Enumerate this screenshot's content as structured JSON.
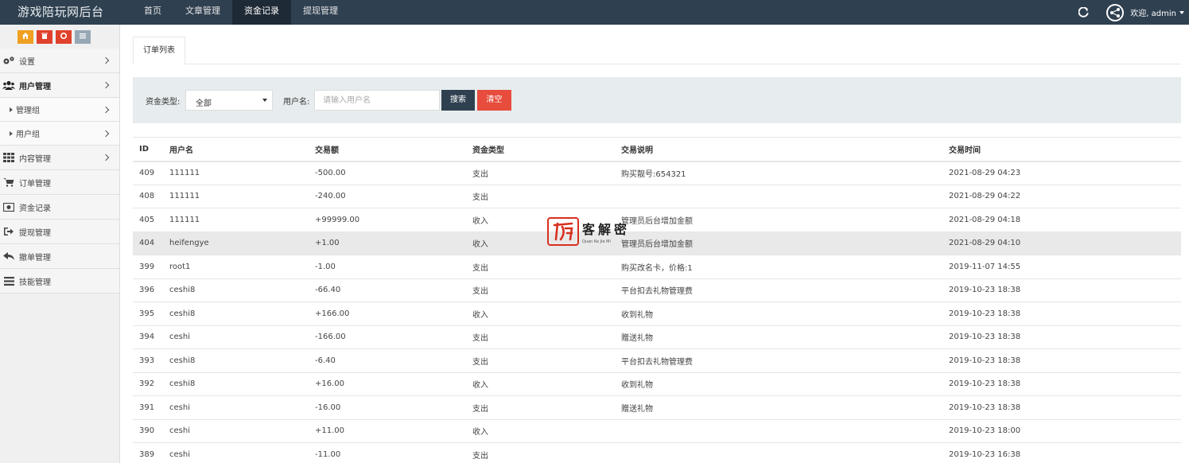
{
  "app": {
    "title": "游戏陪玩网后台"
  },
  "topnav": [
    {
      "label": "首页",
      "active": false
    },
    {
      "label": "文章管理",
      "active": false
    },
    {
      "label": "资金记录",
      "active": true
    },
    {
      "label": "提现管理",
      "active": false
    }
  ],
  "user": {
    "welcome": "欢迎, admin"
  },
  "sidebar": {
    "quick_buttons": [
      {
        "icon": "home-icon",
        "color": "#f0a020"
      },
      {
        "icon": "trash-icon",
        "color": "#e0412c"
      },
      {
        "icon": "recycle-icon",
        "color": "#e0412c"
      },
      {
        "icon": "list-icon",
        "color": "#97a8b5"
      }
    ],
    "items": [
      {
        "label": "设置",
        "icon": "gears-icon",
        "arrow": true
      },
      {
        "label": "用户管理",
        "icon": "users-icon",
        "arrow": true,
        "bold": true
      },
      {
        "label": "管理组",
        "sub": true,
        "arrow": true
      },
      {
        "label": "用户组",
        "sub": true,
        "arrow": true
      },
      {
        "label": "内容管理",
        "icon": "grid-icon",
        "arrow": true
      },
      {
        "label": "订单管理",
        "icon": "cart-icon"
      },
      {
        "label": "资金记录",
        "icon": "money-icon"
      },
      {
        "label": "提现管理",
        "icon": "sign-out-icon"
      },
      {
        "label": "撤单管理",
        "icon": "reply-icon"
      },
      {
        "label": "技能管理",
        "icon": "bars-icon"
      }
    ]
  },
  "tabs": [
    {
      "label": "订单列表"
    }
  ],
  "search": {
    "type_label": "资金类型:",
    "type_value": "全部",
    "user_label": "用户名:",
    "user_placeholder": "请输入用户名",
    "search_button": "搜索",
    "clear_button": "清空"
  },
  "table": {
    "headers": [
      "ID",
      "用户名",
      "交易额",
      "资金类型",
      "交易说明",
      "交易时间"
    ],
    "rows": [
      [
        "409",
        "111111",
        "-500.00",
        "支出",
        "购买靓号:654321",
        "2021-08-29 04:23"
      ],
      [
        "408",
        "111111",
        "-240.00",
        "支出",
        "",
        "2021-08-29 04:22"
      ],
      [
        "405",
        "111111",
        "+99999.00",
        "收入",
        "管理员后台增加金额",
        "2021-08-29 04:18"
      ],
      [
        "404",
        "heifengye",
        "+1.00",
        "收入",
        "管理员后台增加金额",
        "2021-08-29 04:10"
      ],
      [
        "399",
        "root1",
        "-1.00",
        "支出",
        "购买改名卡，价格:1",
        "2019-11-07 14:55"
      ],
      [
        "396",
        "ceshi8",
        "-66.40",
        "支出",
        "平台扣去礼物管理费",
        "2019-10-23 18:38"
      ],
      [
        "395",
        "ceshi8",
        "+166.00",
        "收入",
        "收到礼物",
        "2019-10-23 18:38"
      ],
      [
        "394",
        "ceshi",
        "-166.00",
        "支出",
        "赠送礼物",
        "2019-10-23 18:38"
      ],
      [
        "393",
        "ceshi8",
        "-6.40",
        "支出",
        "平台扣去礼物管理费",
        "2019-10-23 18:38"
      ],
      [
        "392",
        "ceshi8",
        "+16.00",
        "收入",
        "收到礼物",
        "2019-10-23 18:38"
      ],
      [
        "391",
        "ceshi",
        "-16.00",
        "支出",
        "赠送礼物",
        "2019-10-23 18:38"
      ],
      [
        "390",
        "ceshi",
        "+11.00",
        "收入",
        "",
        "2019-10-23 18:00"
      ],
      [
        "389",
        "ceshi",
        "-11.00",
        "支出",
        "",
        "2019-10-23 16:38"
      ]
    ],
    "highlight_row": 3
  },
  "watermark": {
    "main": "客解密",
    "sub": "Quan Ke Jie Mi"
  },
  "colors": {
    "topbar": "#2f4050",
    "search_button": "#2f4050",
    "clear_button": "#e74c3c",
    "accent_orange": "#f0a020"
  }
}
